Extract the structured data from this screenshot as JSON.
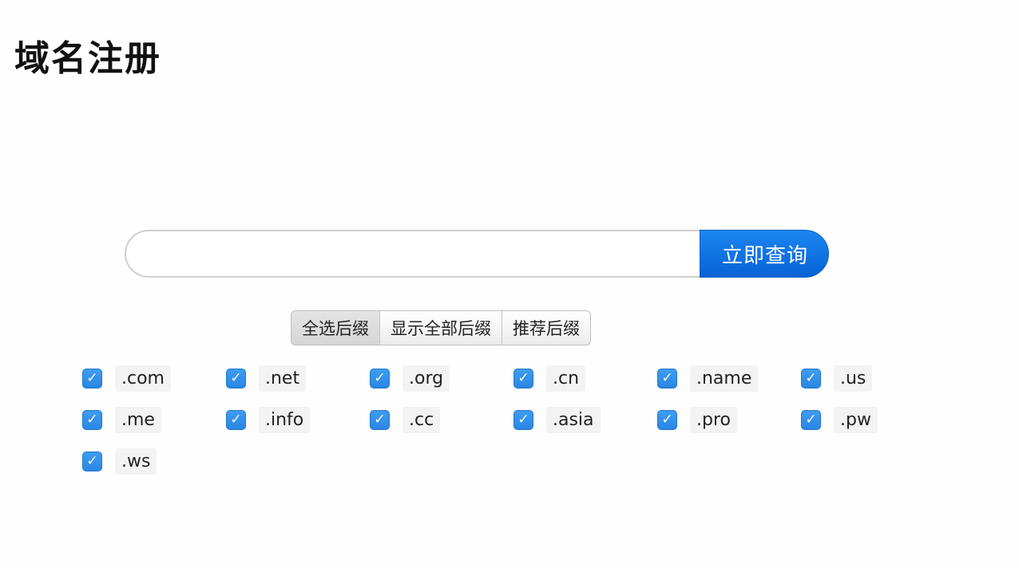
{
  "page_title": "域名注册",
  "search": {
    "input_value": "",
    "input_placeholder": "",
    "button_label": "立即查询",
    "button_color": "#0a6ad8"
  },
  "filter_buttons": [
    {
      "label": "全选后缀",
      "active": true
    },
    {
      "label": "显示全部后缀",
      "active": false
    },
    {
      "label": "推荐后缀",
      "active": false
    }
  ],
  "tlds": [
    {
      "label": ".com",
      "checked": true
    },
    {
      "label": ".net",
      "checked": true
    },
    {
      "label": ".org",
      "checked": true
    },
    {
      "label": ".cn",
      "checked": true
    },
    {
      "label": ".name",
      "checked": true
    },
    {
      "label": ".us",
      "checked": true
    },
    {
      "label": ".me",
      "checked": true
    },
    {
      "label": ".info",
      "checked": true
    },
    {
      "label": ".cc",
      "checked": true
    },
    {
      "label": ".asia",
      "checked": true
    },
    {
      "label": ".pro",
      "checked": true
    },
    {
      "label": ".pw",
      "checked": true
    },
    {
      "label": ".ws",
      "checked": true
    }
  ],
  "checkbox_color": "#2f8ee8",
  "checkmark_icon": "check-icon"
}
